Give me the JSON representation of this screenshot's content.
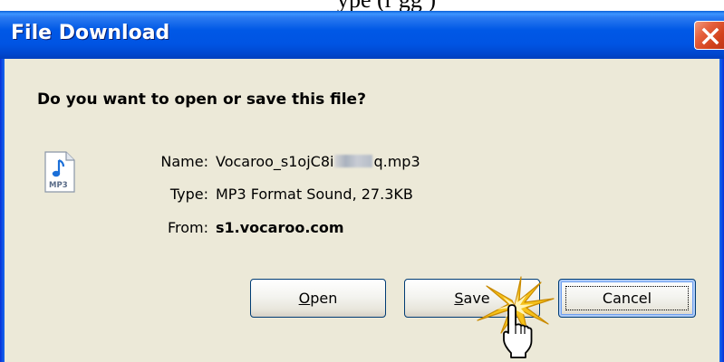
{
  "page_fragment_text": "ype (r         gg       )",
  "window": {
    "title": "File Download",
    "close_icon": "close-icon"
  },
  "dialog": {
    "question": "Do you want to open or save this file?",
    "file_icon": "mp3-file-icon",
    "file_icon_text": "MP3",
    "name_label": "Name:",
    "name_value_prefix": "Vocaroo_s1ojC8i",
    "name_value_suffix": "q.mp3",
    "type_label": "Type:",
    "type_value": "MP3 Format Sound, 27.3KB",
    "from_label": "From:",
    "from_value": "s1.vocaroo.com"
  },
  "buttons": {
    "open_mnemonic": "O",
    "open_rest": "pen",
    "save_mnemonic": "S",
    "save_rest": "ave",
    "cancel": "Cancel"
  },
  "colors": {
    "titlebar": "#0054e3",
    "dialog_bg": "#ece9d8",
    "close_button": "#d2421c",
    "button_border": "#003c74",
    "cancel_focus": "#6d9ef0",
    "burst": "#f6c21a"
  }
}
